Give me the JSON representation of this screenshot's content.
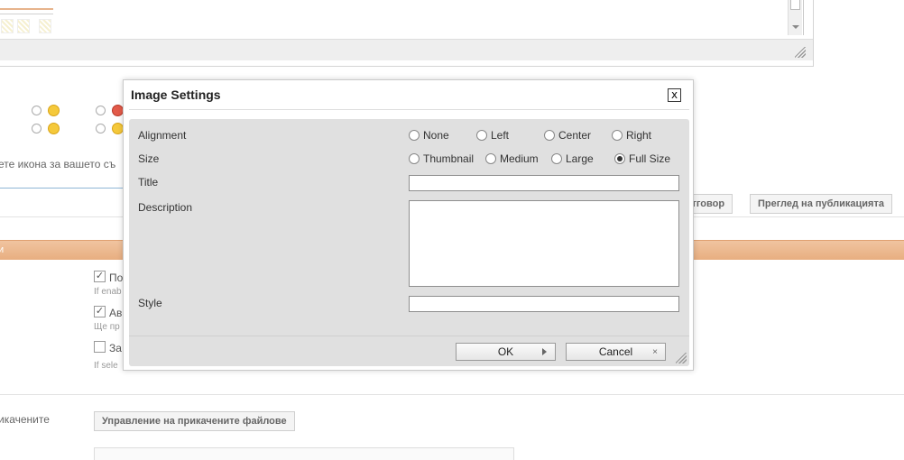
{
  "background": {
    "icon_hint": "ете икона за вашето съ",
    "buttons": {
      "reply": "отговор",
      "preview": "Преглед на публикацията",
      "manage_attachments": "Управление на прикачените файлове"
    },
    "orange_bar_label": "и",
    "options": [
      {
        "label": "По",
        "hint": "If enab",
        "checked": true
      },
      {
        "label": "Ав",
        "hint": "Ще пр",
        "checked": true
      },
      {
        "label": "За",
        "hint": "If sele",
        "checked": false
      }
    ],
    "attachments_label": "икачените"
  },
  "dialog": {
    "title": "Image Settings",
    "close_symbol": "x",
    "alignment": {
      "label": "Alignment",
      "options": [
        "None",
        "Left",
        "Center",
        "Right"
      ],
      "selected": null
    },
    "size": {
      "label": "Size",
      "options": [
        "Thumbnail",
        "Medium",
        "Large",
        "Full Size"
      ],
      "selected": "Full Size"
    },
    "title_field": {
      "label": "Title",
      "value": ""
    },
    "description_field": {
      "label": "Description",
      "value": ""
    },
    "style_field": {
      "label": "Style",
      "value": ""
    },
    "ok_label": "OK",
    "cancel_label": "Cancel",
    "cancel_symbol": "×"
  }
}
